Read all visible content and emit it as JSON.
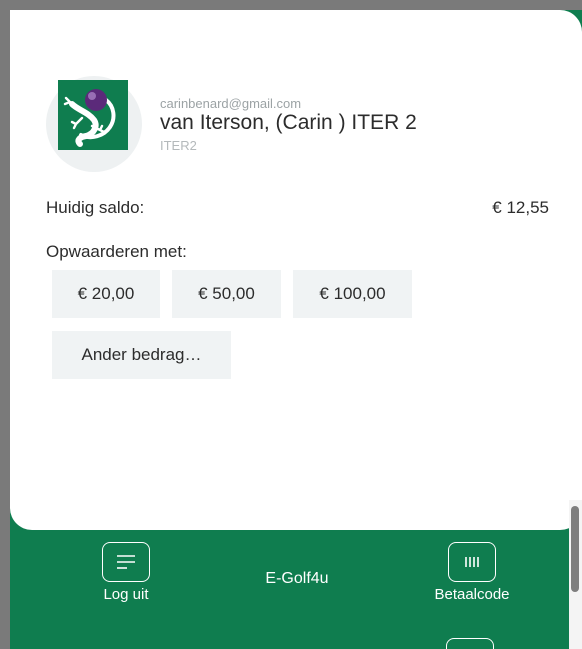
{
  "profile": {
    "email": "carinbenard@gmail.com",
    "name": "van Iterson, (Carin ) ITER 2",
    "code": "ITER2",
    "logo_icon": "lizard-golfball-logo-icon"
  },
  "balance": {
    "label": "Huidig saldo:",
    "value": "€ 12,55"
  },
  "topup": {
    "label": "Opwaarderen met:",
    "options": [
      "€ 20,00",
      "€ 50,00",
      "€ 100,00"
    ],
    "other_label": "Ander bedrag…"
  },
  "nav": {
    "logout_label": "Log uit",
    "brand": "E-Golf4u",
    "pay_code_label": "Betaalcode",
    "logout_icon": "menu-lines-icon",
    "pay_code_icon": "barcode-icon"
  },
  "colors": {
    "brand_green": "#0f7d4f",
    "button_bg": "#f0f3f4"
  }
}
